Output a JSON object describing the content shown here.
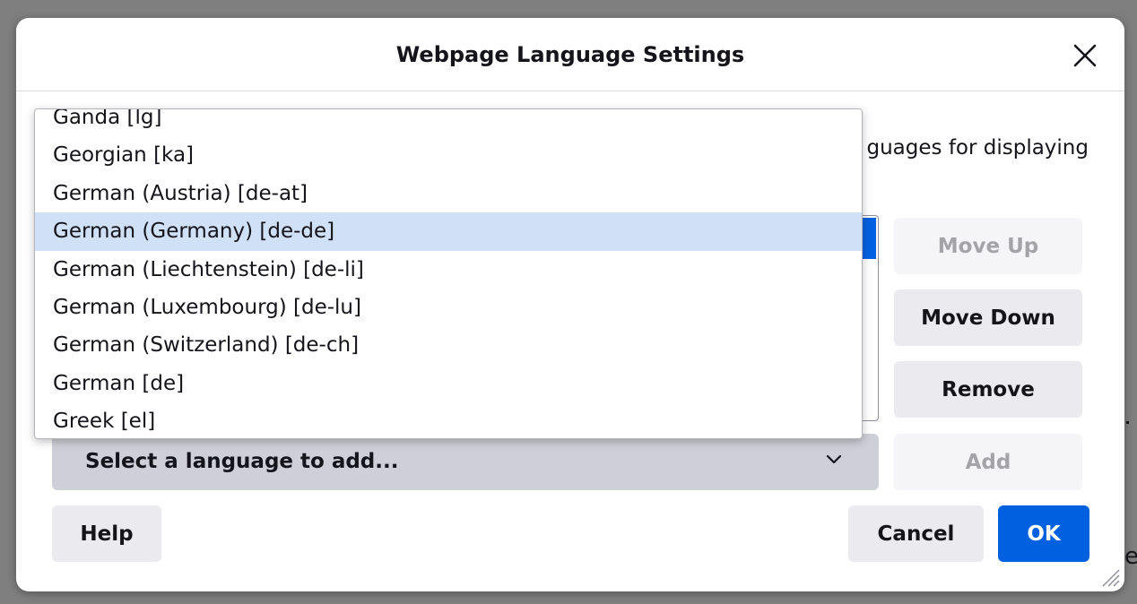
{
  "dialog": {
    "title": "Webpage Language Settings",
    "description_visible": "guages for displaying",
    "buttons": {
      "move_up": "Move Up",
      "move_down": "Move Down",
      "remove": "Remove",
      "add": "Add",
      "help": "Help",
      "cancel": "Cancel",
      "ok": "OK"
    },
    "select": {
      "label": "Select a language to add..."
    },
    "accent_color": "#0061e0"
  },
  "dropdown": {
    "options": [
      "Ganda [lg]",
      "Georgian [ka]",
      "German (Austria) [de-at]",
      "German (Germany) [de-de]",
      "German (Liechtenstein) [de-li]",
      "German (Luxembourg) [de-lu]",
      "German (Switzerland) [de-ch]",
      "German [de]",
      "Greek [el]"
    ],
    "highlighted_index": 3,
    "highlight_color": "#cfe0f7"
  },
  "background": {
    "edge_char": "e"
  }
}
